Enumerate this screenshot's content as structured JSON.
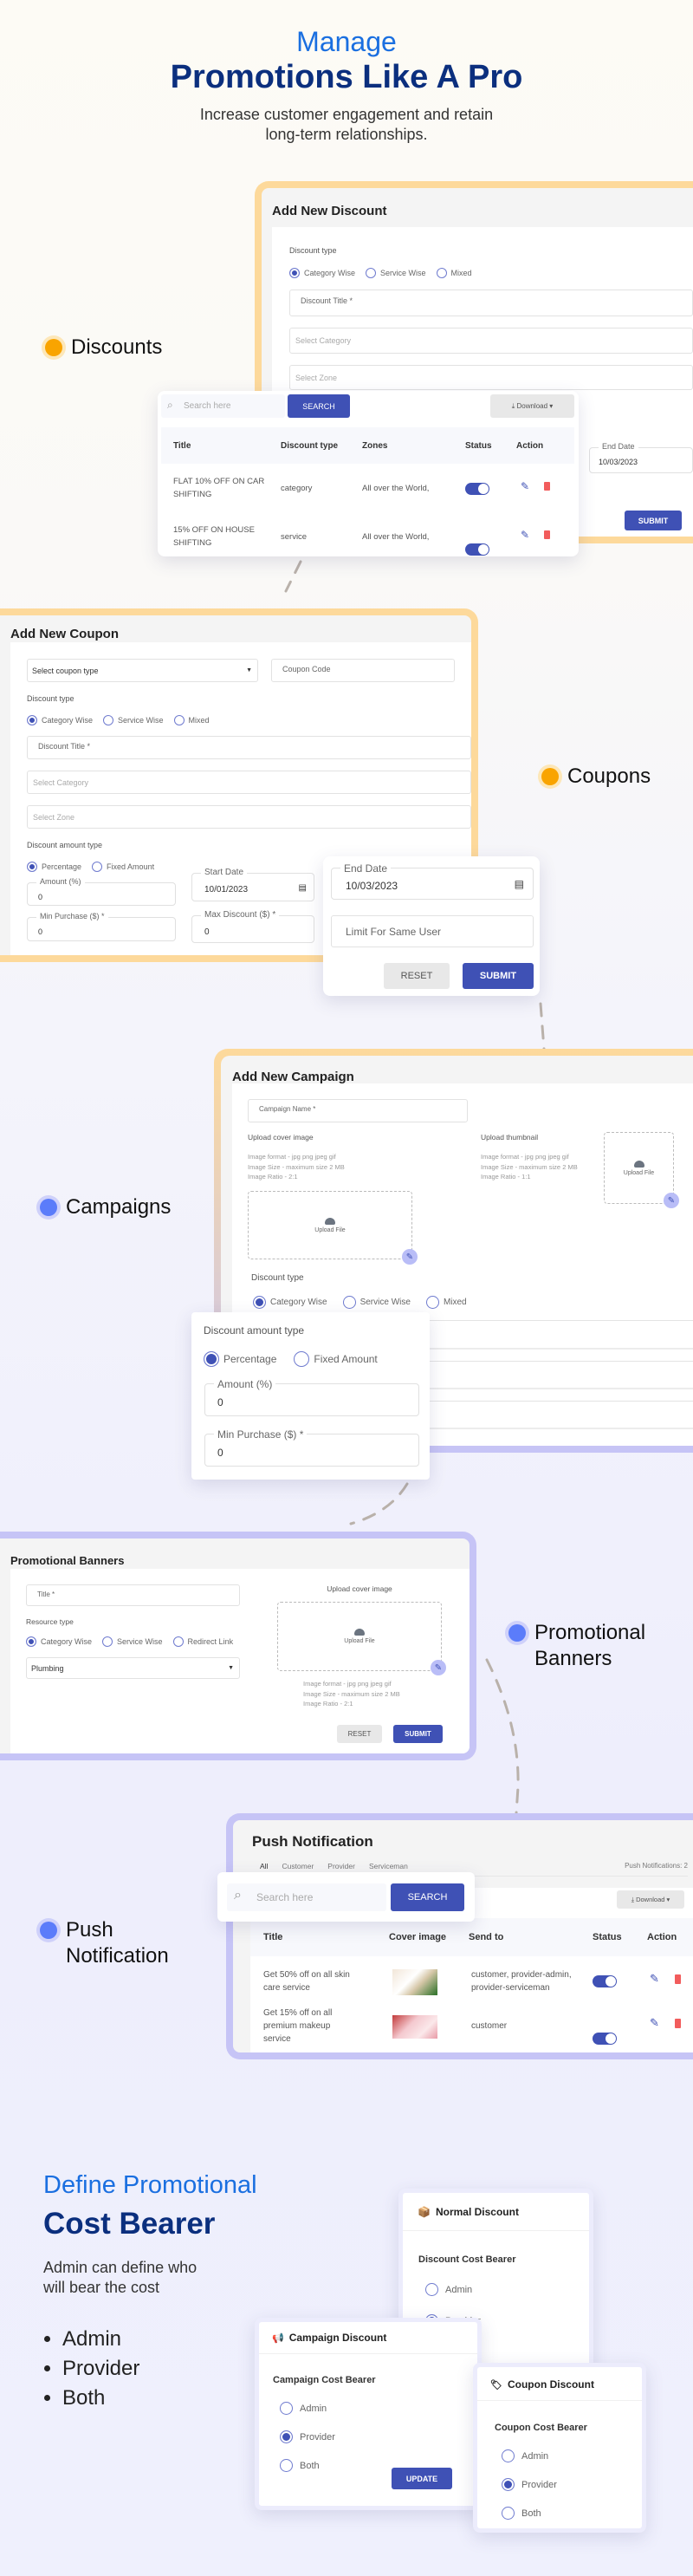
{
  "colors": {
    "accent": "#3f51b5",
    "heading_blue": "#1a6fe0",
    "heading_navy": "#0b2f7e",
    "orange_dot": "#f9a400",
    "blue_dot": "#5b7cfa",
    "delete_red": "#f25c5c"
  },
  "hero": {
    "line1": "Manage",
    "line2": "Promotions Like A Pro",
    "subtitle1": "Increase customer engagement and retain",
    "subtitle2": "long-term relationships."
  },
  "features": {
    "discounts": "Discounts",
    "coupons": "Coupons",
    "campaigns": "Campaigns",
    "banners1": "Promotional",
    "banners2": "Banners",
    "push1": "Push",
    "push2": "Notification"
  },
  "discount_form": {
    "title": "Add New Discount",
    "discount_type": "Discount type",
    "options": [
      "Category Wise",
      "Service Wise",
      "Mixed"
    ],
    "selected": "Category Wise",
    "title_ph": "Discount Title *",
    "category_ph": "Select Category",
    "zone_ph": "Select Zone",
    "end_date_label": "End Date",
    "end_date": "10/03/2023",
    "submit": "SUBMIT"
  },
  "discount_table": {
    "search_ph": "Search here",
    "search": "SEARCH",
    "download": "Download",
    "columns": [
      "Title",
      "Discount type",
      "Zones",
      "Status",
      "Action"
    ],
    "rows": [
      {
        "title1": "FLAT 10% OFF ON CAR",
        "title2": "SHIFTING",
        "type": "category",
        "zones": "All over the World,",
        "active": true
      },
      {
        "title1": "15% OFF ON HOUSE",
        "title2": "SHIFTING",
        "type": "service",
        "zones": "All over the World,",
        "active": true
      }
    ]
  },
  "coupon_form": {
    "title": "Add New Coupon",
    "coupon_type_ph": "Select coupon type",
    "coupon_code_ph": "Coupon Code",
    "discount_type": "Discount type",
    "options": [
      "Category Wise",
      "Service Wise",
      "Mixed"
    ],
    "title_ph": "Discount Title *",
    "category_ph": "Select Category",
    "zone_ph": "Select Zone",
    "amount_type": "Discount amount type",
    "amount_options": [
      "Percentage",
      "Fixed Amount"
    ],
    "amount_label": "Amount (%)",
    "amount": "0",
    "start_label": "Start Date",
    "start": "10/01/2023",
    "min_label": "Min Purchase ($) *",
    "min": "0",
    "max_label": "Max Discount ($) *",
    "max": "0",
    "end_label": "End Date",
    "end": "10/03/2023",
    "limit_ph": "Limit For Same User",
    "reset": "RESET",
    "submit": "SUBMIT"
  },
  "campaign_form": {
    "title": "Add New Campaign",
    "name_ph": "Campaign Name *",
    "cover_label": "Upload cover image",
    "cover_hints": [
      "Image format - jpg png jpeg gif",
      "Image Size - maximum size 2 MB",
      "Image Ratio - 2:1"
    ],
    "thumb_label": "Upload thumbnail",
    "thumb_hints": [
      "Image format - jpg png jpeg gif",
      "Image Size - maximum size 2 MB",
      "Image Ratio - 1:1"
    ],
    "upload": "Upload File",
    "discount_type": "Discount type",
    "options": [
      "Category Wise",
      "Service Wise",
      "Mixed"
    ],
    "amount_type": "Discount amount type",
    "amount_options": [
      "Percentage",
      "Fixed Amount"
    ],
    "amount_label": "Amount (%)",
    "amount": "0",
    "min_label": "Min Purchase ($) *",
    "min": "0"
  },
  "banner_form": {
    "title": "Promotional Banners",
    "title_ph": "Title *",
    "resource_type": "Resource type",
    "options": [
      "Category Wise",
      "Service Wise",
      "Redirect Link"
    ],
    "resource": "Plumbing",
    "cover_label": "Upload cover image",
    "upload": "Upload File",
    "hints": [
      "Image format - jpg png jpeg gif",
      "Image Size - maximum size 2 MB",
      "Image Ratio - 2:1"
    ],
    "reset": "RESET",
    "submit": "SUBMIT"
  },
  "push": {
    "title": "Push Notification",
    "tabs": [
      "All",
      "Customer",
      "Provider",
      "Serviceman"
    ],
    "count": "Push Notifications: 2",
    "search_ph": "Search here",
    "search": "SEARCH",
    "download": "Download",
    "columns": [
      "Title",
      "Cover image",
      "Send to",
      "Status",
      "Action"
    ],
    "rows": [
      {
        "title1": "Get 50% off on all skin",
        "title2": "care service",
        "title3": "",
        "send1": "customer, provider-admin,",
        "send2": "provider-serviceman",
        "active": true
      },
      {
        "title1": "Get 15% off on all",
        "title2": "premium makeup",
        "title3": "service",
        "send1": "customer",
        "send2": "",
        "active": true
      }
    ]
  },
  "cost": {
    "line1": "Define Promotional",
    "line2": "Cost Bearer",
    "desc1": "Admin can define who",
    "desc2": "will bear the cost",
    "bullets": [
      "Admin",
      "Provider",
      "Both"
    ],
    "normal": {
      "title": "Normal Discount",
      "label": "Discount Cost Bearer",
      "selected": "Provider"
    },
    "campaign": {
      "title": "Campaign Discount",
      "label": "Campaign Cost Bearer",
      "selected": "Provider",
      "update": "UPDATE"
    },
    "coupon": {
      "title": "Coupon Discount",
      "label": "Coupon Cost Bearer",
      "selected": "Provider"
    },
    "options": [
      "Admin",
      "Provider",
      "Both"
    ]
  }
}
